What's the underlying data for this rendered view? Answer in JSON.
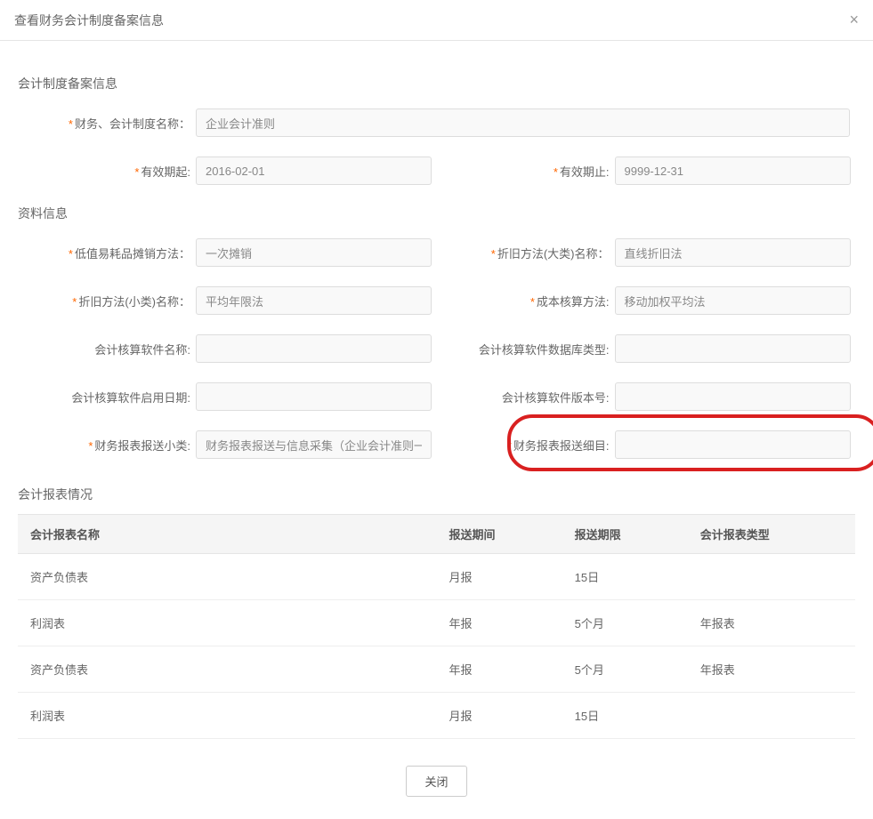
{
  "header": {
    "title": "查看财务会计制度备案信息"
  },
  "section1": {
    "title": "会计制度备案信息",
    "fields": {
      "system_name_label": "财务、会计制度名称：",
      "system_name_value": "企业会计准则",
      "valid_from_label": "有效期起:",
      "valid_from_value": "2016-02-01",
      "valid_to_label": "有效期止:",
      "valid_to_value": "9999-12-31"
    }
  },
  "section2": {
    "title": "资料信息",
    "fields": {
      "low_value_label": "低值易耗品摊销方法：",
      "low_value_value": "一次摊销",
      "depr_major_label": "折旧方法(大类)名称：",
      "depr_major_value": "直线折旧法",
      "depr_minor_label": "折旧方法(小类)名称：",
      "depr_minor_value": "平均年限法",
      "cost_method_label": "成本核算方法:",
      "cost_method_value": "移动加权平均法",
      "software_name_label": "会计核算软件名称:",
      "software_name_value": "",
      "db_type_label": "会计核算软件数据库类型:",
      "db_type_value": "",
      "enable_date_label": "会计核算软件启用日期:",
      "enable_date_value": "",
      "version_label": "会计核算软件版本号:",
      "version_value": "",
      "report_sub_label": "财务报表报送小类:",
      "report_sub_value": "财务报表报送与信息采集（企业会计准则一般企业",
      "report_detail_label": "财务报表报送细目:",
      "report_detail_value": ""
    }
  },
  "table": {
    "title": "会计报表情况",
    "headers": {
      "name": "会计报表名称",
      "period": "报送期间",
      "deadline": "报送期限",
      "type": "会计报表类型"
    },
    "rows": [
      {
        "name": "资产负债表",
        "period": "月报",
        "deadline": "15日",
        "type": ""
      },
      {
        "name": "利润表",
        "period": "年报",
        "deadline": "5个月",
        "type": "年报表"
      },
      {
        "name": "资产负债表",
        "period": "年报",
        "deadline": "5个月",
        "type": "年报表"
      },
      {
        "name": "利润表",
        "period": "月报",
        "deadline": "15日",
        "type": ""
      }
    ]
  },
  "footer": {
    "close_label": "关闭"
  }
}
